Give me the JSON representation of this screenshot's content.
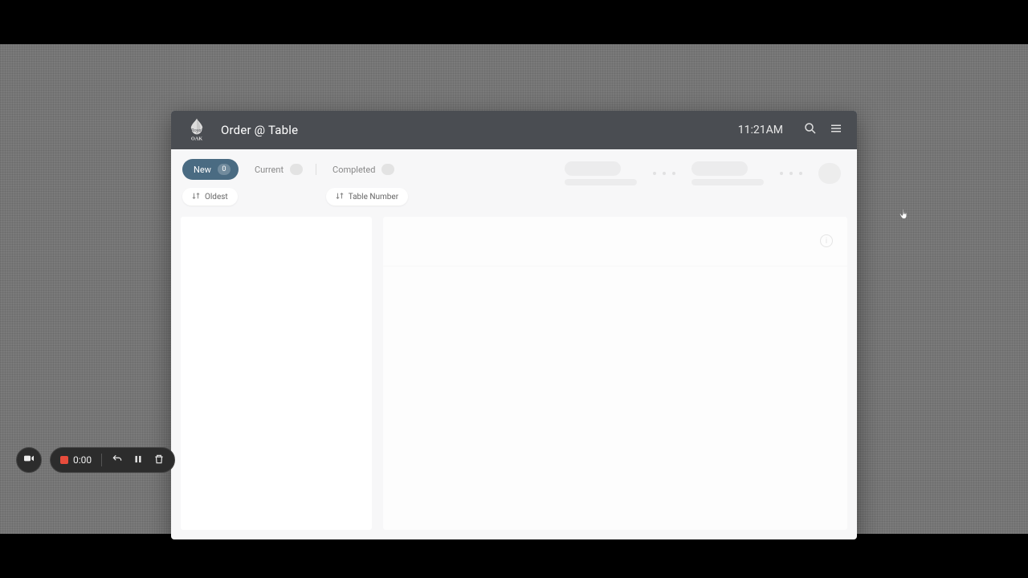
{
  "header": {
    "title": "Order @ Table",
    "time": "11:21AM",
    "logo_text_top": "Royal",
    "logo_text_bottom": "Oak"
  },
  "tabs": [
    {
      "label": "New",
      "count": "0",
      "active": true
    },
    {
      "label": "Current",
      "count": "",
      "active": false
    },
    {
      "label": "Completed",
      "count": "",
      "active": false
    }
  ],
  "sort": {
    "primary": "Oldest",
    "secondary": "Table Number"
  },
  "recorder": {
    "time": "0:00"
  }
}
